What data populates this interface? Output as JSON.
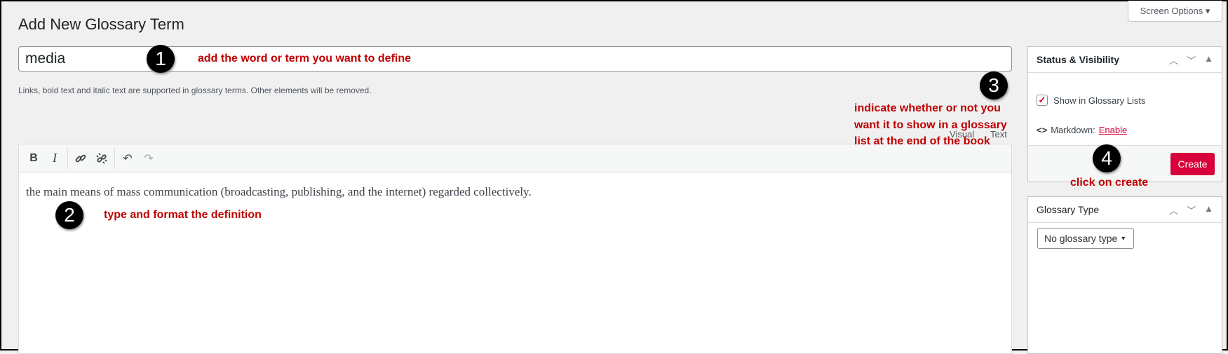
{
  "page": {
    "title": "Add New Glossary Term",
    "screen_options": "Screen Options ▾"
  },
  "term": {
    "value": "media",
    "help": "Links, bold text and italic text are supported in glossary terms. Other elements will be removed."
  },
  "editor": {
    "tabs": [
      "Visual",
      "Text"
    ],
    "toolbar": [
      "bold-icon",
      "italic-icon",
      "link-icon",
      "unlink-icon",
      "undo-icon",
      "redo-icon"
    ],
    "content": "the main means of mass communication (broadcasting, publishing, and the internet) regarded collectively."
  },
  "status_box": {
    "title": "Status & Visibility",
    "checkbox_label": "Show in Glossary Lists",
    "checked": true,
    "markdown_label": "Markdown:",
    "markdown_link": "Enable",
    "create": "Create"
  },
  "type_box": {
    "title": "Glossary Type",
    "select": "No glossary type"
  },
  "annotations": [
    {
      "num": "1",
      "text": "add the word or term you want to define"
    },
    {
      "num": "2",
      "text": "type and format the definition"
    },
    {
      "num": "3",
      "lines": [
        "indicate whether or not you",
        "want it to show in a glossary",
        "list at the end of the book"
      ]
    },
    {
      "num": "4",
      "text": "click on create"
    }
  ],
  "colors": {
    "accent": "#d7003a",
    "annotation": "#c00000"
  }
}
